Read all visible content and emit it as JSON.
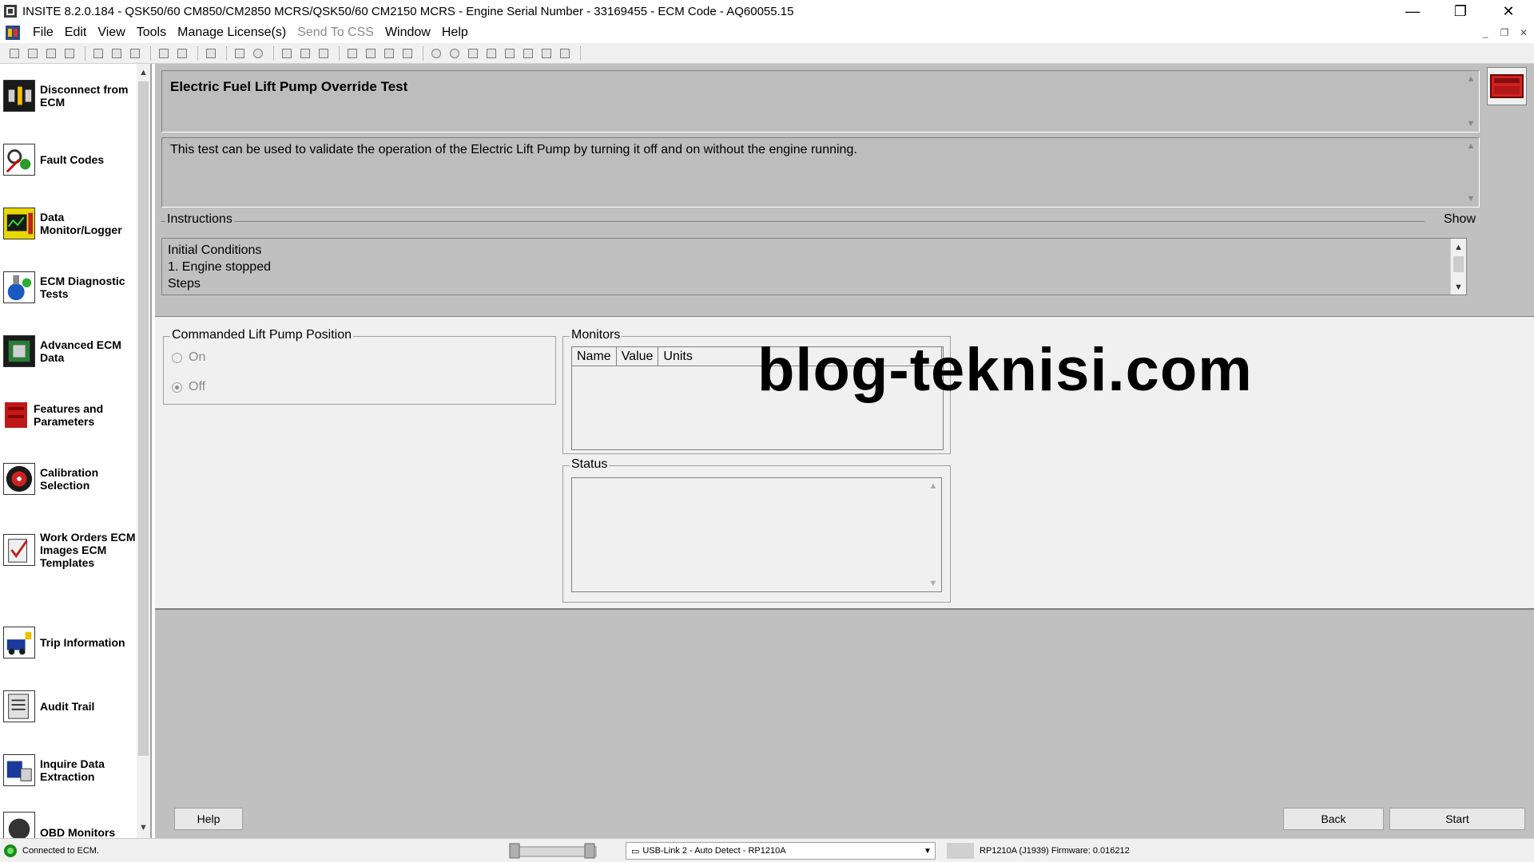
{
  "window": {
    "title": "INSITE 8.2.0.184  -  QSK50/60 CM850/CM2850 MCRS/QSK50/60 CM2150 MCRS - Engine Serial Number - 33169455 - ECM Code - AQ60055.15",
    "minimize": "—",
    "restore": "❐",
    "close": "✕"
  },
  "menu": {
    "items": [
      "File",
      "Edit",
      "View",
      "Tools",
      "Manage License(s)",
      "Send To CSS",
      "Window",
      "Help"
    ],
    "disabled": [
      "Send To CSS"
    ],
    "mdi_minimize": "_",
    "mdi_restore": "❐",
    "mdi_close": "✕"
  },
  "sidebar": {
    "items": [
      {
        "label": "Disconnect from ECM",
        "icon": "disconnect-icon"
      },
      {
        "label": "Fault Codes",
        "icon": "fault-codes-icon"
      },
      {
        "label": "Data Monitor/Logger",
        "icon": "data-monitor-icon"
      },
      {
        "label": "ECM Diagnostic Tests",
        "icon": "diagnostic-tests-icon"
      },
      {
        "label": "Advanced ECM Data",
        "icon": "advanced-data-icon"
      },
      {
        "label": "Features and Parameters",
        "icon": "features-icon"
      },
      {
        "label": "Calibration Selection",
        "icon": "calibration-icon"
      },
      {
        "label": "Work Orders ECM Images ECM Templates",
        "icon": "work-orders-icon"
      },
      {
        "label": "Trip Information",
        "icon": "trip-info-icon"
      },
      {
        "label": "Audit Trail",
        "icon": "audit-trail-icon"
      },
      {
        "label": "Inquire Data Extraction",
        "icon": "inquire-icon"
      },
      {
        "label": "OBD Monitors",
        "icon": "obd-icon"
      }
    ]
  },
  "test": {
    "title": "Electric Fuel Lift Pump Override Test",
    "description": "This test can be used to validate the operation of the Electric Lift Pump by turning it off and on without the engine running."
  },
  "instructions": {
    "legend": "Instructions",
    "show_label": "Show",
    "lines": [
      "Initial Conditions",
      "1. Engine stopped",
      "Steps"
    ]
  },
  "lift_pump": {
    "legend": "Commanded Lift Pump Position",
    "options": [
      "On",
      "Off"
    ],
    "selected": "Off"
  },
  "monitors": {
    "legend": "Monitors",
    "columns": [
      "Name",
      "Value",
      "Units"
    ]
  },
  "status": {
    "legend": "Status"
  },
  "buttons": {
    "help": "Help",
    "back": "Back",
    "start": "Start"
  },
  "watermark": "blog-teknisi.com",
  "statusbar": {
    "connection": "Connected to ECM.",
    "adapter": "USB-Link 2 - Auto Detect - RP1210A",
    "protocol": "RP1210A (J1939)  Firmware: 0.016212"
  },
  "colors": {
    "panel_gray": "#bdbdbd",
    "dialog_bg": "#f0f0f0",
    "logo_red": "#d42020"
  }
}
